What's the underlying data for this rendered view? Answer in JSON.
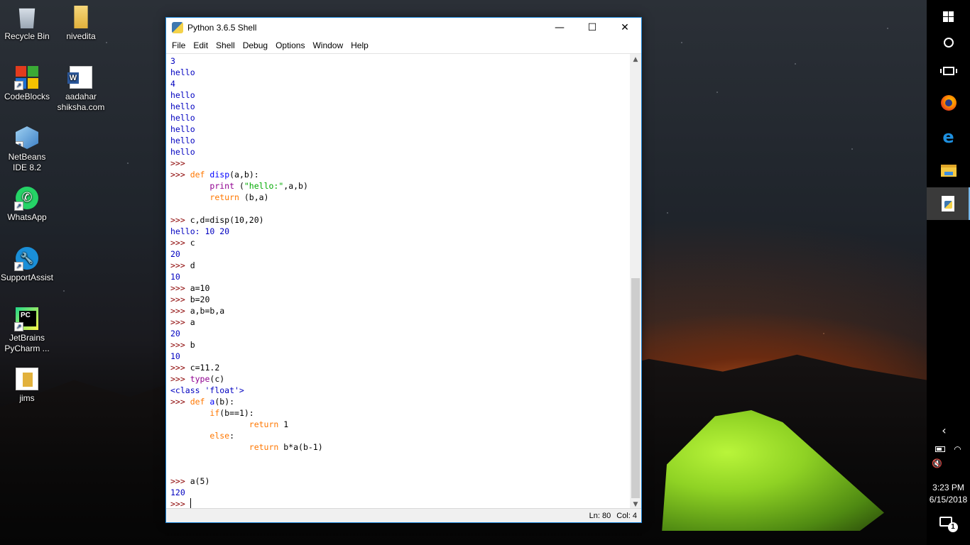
{
  "desktop": {
    "icons": [
      {
        "label": "Recycle Bin",
        "icon": "recycle-bin-icon"
      },
      {
        "label": "nivedita",
        "icon": "folder-icon"
      },
      {
        "label": "CodeBlocks",
        "icon": "codeblocks-icon"
      },
      {
        "label": "aadahar shiksha.com",
        "icon": "word-document-icon"
      },
      {
        "label": "NetBeans IDE 8.2",
        "icon": "netbeans-icon"
      },
      {
        "label": "WhatsApp",
        "icon": "whatsapp-icon"
      },
      {
        "label": "SupportAssist",
        "icon": "supportassist-icon"
      },
      {
        "label": "JetBrains PyCharm ...",
        "icon": "pycharm-icon"
      },
      {
        "label": "jims",
        "icon": "file-icon"
      }
    ]
  },
  "window": {
    "title": "Python 3.6.5 Shell",
    "minimize": "—",
    "maximize": "☐",
    "close": "✕",
    "menu": [
      "File",
      "Edit",
      "Shell",
      "Debug",
      "Options",
      "Window",
      "Help"
    ],
    "status": {
      "ln": "Ln: 80",
      "col": "Col: 4"
    },
    "accent": "#1883d7"
  },
  "shell": {
    "prompt": ">>> ",
    "lines": [
      "3",
      "hello",
      "4",
      "hello",
      "hello",
      "hello",
      "hello",
      "hello",
      "hello",
      ">>> ",
      ">>> def disp(a,b):",
      "        print (\"hello:\",a,b)",
      "        return (b,a)",
      "",
      ">>> c,d=disp(10,20)",
      "hello: 10 20",
      ">>> c",
      "20",
      ">>> d",
      "10",
      ">>> a=10",
      ">>> b=20",
      ">>> a,b=b,a",
      ">>> a",
      "20",
      ">>> b",
      "10",
      ">>> c=11.2",
      ">>> type(c)",
      "<class 'float'>",
      ">>> def a(b):",
      "        if(b==1):",
      "                return 1",
      "        else:",
      "                return b*a(b-1)",
      "",
      "",
      ">>> a(5)",
      "120",
      ">>> "
    ]
  },
  "taskbar": {
    "items": [
      "start-icon",
      "cortana-icon",
      "task-view-icon",
      "firefox-icon",
      "edge-icon",
      "file-explorer-icon",
      "python-file-icon"
    ],
    "tray": {
      "chevron": "‹",
      "battery": "battery-icon",
      "wifi": "wifi-icon",
      "volume": "volume-muted-icon"
    },
    "time": "3:23 PM",
    "date": "6/15/2018",
    "notifications_count": "1"
  }
}
